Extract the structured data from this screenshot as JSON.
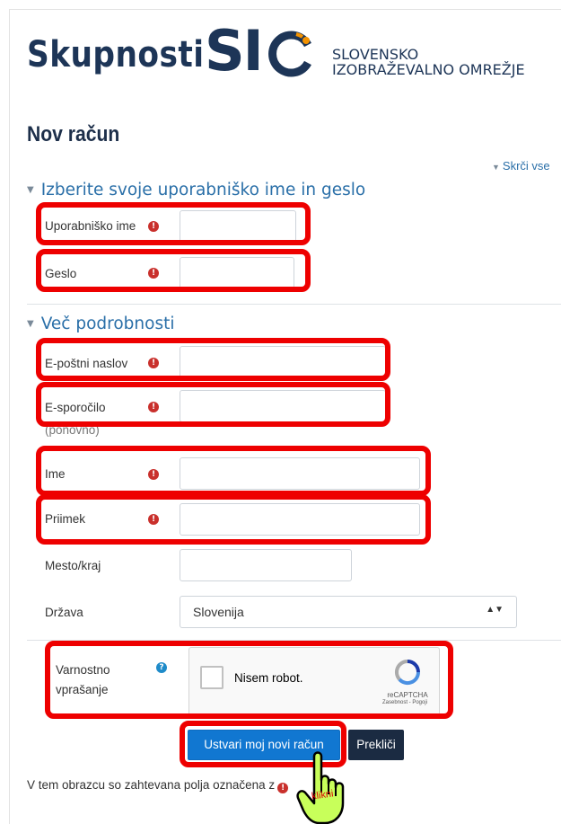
{
  "header": {
    "logo_word": "Skupnosti",
    "logo_sio": "SI",
    "logo_sub_line1": "SLOVENSKO",
    "logo_sub_line2": "IZOBRAŽEVALNO OMREŽJE"
  },
  "page_title": "Nov račun",
  "collapse_all": "Skrči vse",
  "section1": {
    "title": "Izberite svoje uporabniško ime in geslo",
    "fields": [
      {
        "label": "Uporabniško ime",
        "value": ""
      },
      {
        "label": "Geslo",
        "value": ""
      }
    ]
  },
  "section2": {
    "title": "Več podrobnosti",
    "fields": [
      {
        "label": "E-poštni naslov",
        "value": ""
      },
      {
        "label": "E-sporočilo",
        "label2": "(ponovno)",
        "value": ""
      },
      {
        "label": "Ime",
        "value": ""
      },
      {
        "label": "Priimek",
        "value": ""
      },
      {
        "label": "Mesto/kraj",
        "value": ""
      }
    ],
    "country_label": "Država",
    "country_value": "Slovenija",
    "security_label_line1": "Varnostno",
    "security_label_line2": "vprašanje"
  },
  "captcha": {
    "text": "Nisem robot.",
    "brand": "reCAPTCHA",
    "links": "Zasebnost - Pogoji"
  },
  "buttons": {
    "submit": "Ustvari moj novi račun",
    "cancel": "Prekliči"
  },
  "footnote": "V tem obrazcu so zahtevana polja označena z",
  "annotation": "klikni",
  "colors": {
    "brand_navy": "#1d3557",
    "brand_orange": "#f39200",
    "link_blue": "#2a6fa8",
    "required_red": "#c9302c",
    "highlight_red": "#ee0000",
    "primary_button": "#1177d1",
    "cancel_button": "#1b2b42"
  }
}
